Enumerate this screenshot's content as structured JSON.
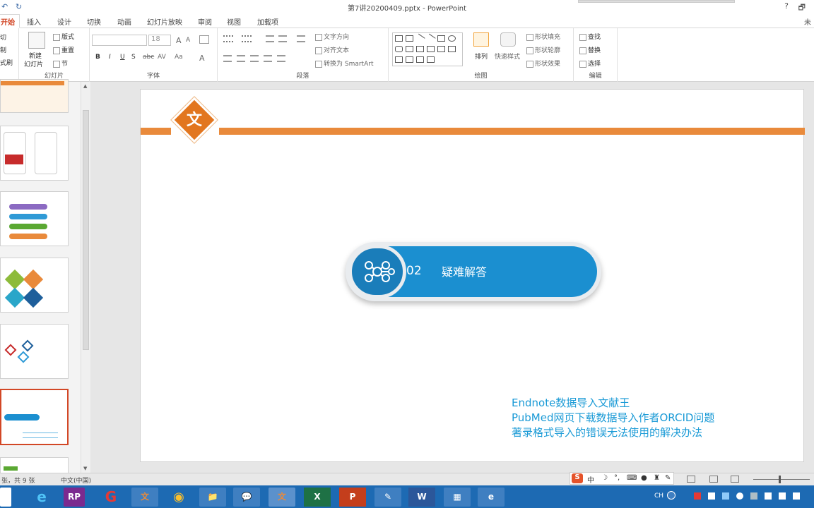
{
  "window": {
    "title": "第7讲20200409.pptx - PowerPoint",
    "help": "?",
    "restore": "🗗",
    "user": "未"
  },
  "quick_access": {
    "undo": "↶",
    "redo": "↻"
  },
  "tabs": [
    "开始",
    "插入",
    "设计",
    "切换",
    "动画",
    "幻灯片放映",
    "审阅",
    "视图",
    "加载项"
  ],
  "ribbon": {
    "clipboard": {
      "cut": "切",
      "copy": "制",
      "painter": "式刷"
    },
    "slides": {
      "new_slide": "新建",
      "new_slide2": "幻灯片",
      "layout": "版式",
      "reset": "重置",
      "section": "节",
      "label": "幻灯片"
    },
    "font": {
      "name": "",
      "size": "18",
      "label": "字体",
      "bold": "B",
      "italic": "I",
      "underline": "U",
      "shadow": "S",
      "strike": "abc",
      "spacing": "AV",
      "case": "Aa",
      "color": "A",
      "grow": "A",
      "shrink": "A"
    },
    "paragraph": {
      "text_direction": "文字方向",
      "align_text": "对齐文本",
      "smartart": "转换为 SmartArt",
      "label": "段落"
    },
    "drawing": {
      "arrange": "排列",
      "quick_styles": "快速样式",
      "fill": "形状填充",
      "outline": "形状轮廓",
      "effects": "形状效果",
      "label": "绘图"
    },
    "editing": {
      "find": "查找",
      "replace": "替换",
      "select": "选择",
      "label": "编辑"
    }
  },
  "slide": {
    "logo": "文",
    "section_number": "02",
    "section_title": "疑难解答",
    "notes": [
      "Endnote数据导入文献王",
      "PubMed网页下载数据导入作者ORCID问题",
      "著录格式导入的错误无法使用的解决办法"
    ]
  },
  "status": {
    "slide_info": "张，共 9 张",
    "language": "中文(中国)"
  },
  "ime": {
    "label": "中"
  },
  "tray": {
    "lang": "CH"
  },
  "taskbar": [
    "e",
    "RP",
    "G",
    "文",
    "◉",
    "📁",
    "💬",
    "文",
    "X",
    "P",
    "✎",
    "W",
    "▦",
    "e"
  ],
  "colors": {
    "accent": "#d24726",
    "orange": "#e98a3b",
    "blue": "#1b8fd0",
    "note": "#1a9ad6",
    "taskbar": "#1d6ab3"
  }
}
